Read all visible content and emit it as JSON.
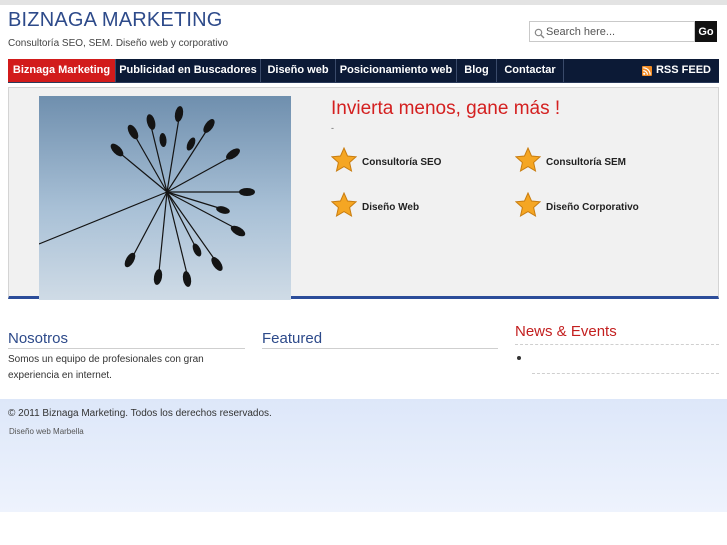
{
  "header": {
    "title": "BIZNAGA MARKETING",
    "tagline": "Consultoría SEO, SEM. Diseño web y corporativo"
  },
  "search": {
    "placeholder": "Search here...",
    "button_label": "Go"
  },
  "nav": {
    "items": [
      {
        "label": "Biznaga Marketing",
        "active": true
      },
      {
        "label": "Publicidad en Buscadores"
      },
      {
        "label": "Diseño web"
      },
      {
        "label": "Posicionamiento web"
      },
      {
        "label": "Blog"
      },
      {
        "label": "Contactar"
      }
    ],
    "rss_label": "RSS FEED"
  },
  "feature": {
    "heading": "Invierta menos, gane más !",
    "subtext": "-",
    "services": [
      {
        "label": "Consultoría SEO",
        "icon": "star-icon"
      },
      {
        "label": "Consultoría SEM",
        "icon": "star-icon"
      },
      {
        "label": "Diseño Web",
        "icon": "star-icon"
      },
      {
        "label": "Diseño Corporativo",
        "icon": "star-icon"
      }
    ]
  },
  "columns": {
    "nosotros": {
      "title": "Nosotros",
      "text": "Somos un equipo de profesionales con gran experiencia en internet."
    },
    "featured": {
      "title": "Featured"
    },
    "news": {
      "title": "News & Events"
    }
  },
  "footer": {
    "copyright": "© 2011 Biznaga Marketing. Todos los derechos reservados.",
    "credit": "Diseño web Marbella"
  },
  "colors": {
    "brand_blue": "#2d4a8a",
    "nav_background": "#0c1a36",
    "active_red": "#d21b1b",
    "heading_red": "#d42020",
    "star_orange": "#f5a623"
  }
}
